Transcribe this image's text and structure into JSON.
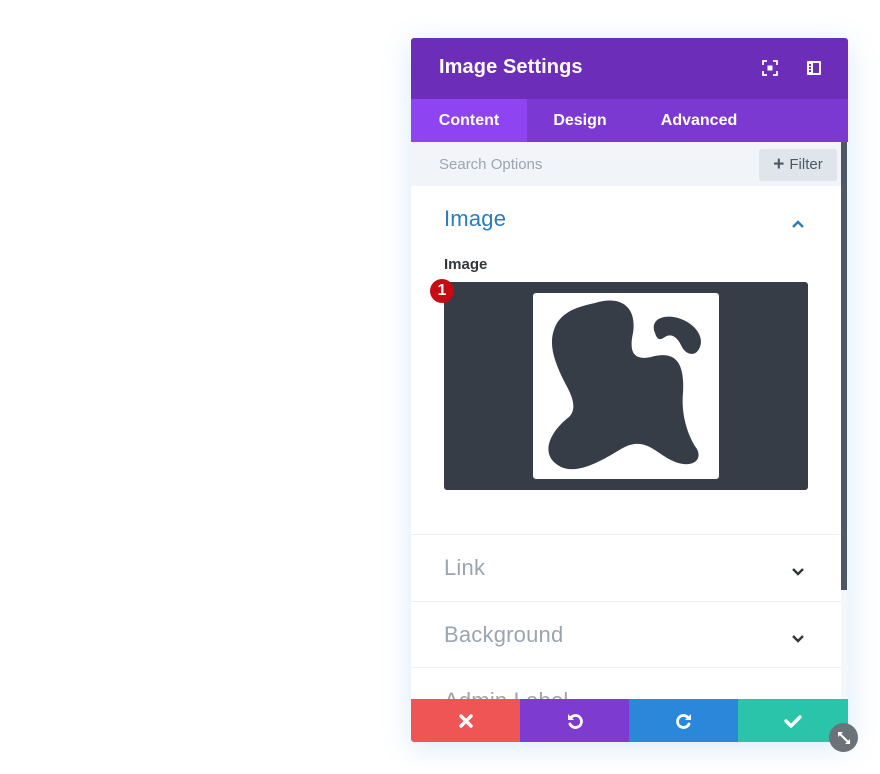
{
  "modal": {
    "title": "Image Settings",
    "header_icons": [
      "expand-icon",
      "sidebar-layout-icon"
    ]
  },
  "tabs": [
    {
      "label": "Content",
      "active": true
    },
    {
      "label": "Design",
      "active": false
    },
    {
      "label": "Advanced",
      "active": false
    }
  ],
  "search": {
    "placeholder": "Search Options",
    "value": "",
    "filter_label": "Filter"
  },
  "sections": [
    {
      "title": "Image",
      "expanded": true
    },
    {
      "title": "Link",
      "expanded": false
    },
    {
      "title": "Background",
      "expanded": false
    },
    {
      "title": "Admin Label",
      "expanded": false
    }
  ],
  "image_field": {
    "label": "Image",
    "badge": "1",
    "preview": "abstract-blob-shape"
  },
  "footer": {
    "buttons": [
      {
        "name": "cancel",
        "icon": "close-icon",
        "color": "#ef5555"
      },
      {
        "name": "undo",
        "icon": "undo-icon",
        "color": "#7e3bd0"
      },
      {
        "name": "redo",
        "icon": "redo-icon",
        "color": "#2b87da"
      },
      {
        "name": "save",
        "icon": "check-icon",
        "color": "#29c4a9"
      }
    ]
  },
  "colors": {
    "header": "#6c2eb9",
    "tabs_bg": "#7b39d1",
    "tab_active": "#8e44f0",
    "section_open": "#2c7bbf",
    "section_closed": "#9aa5b1",
    "badge": "#c60b12"
  }
}
